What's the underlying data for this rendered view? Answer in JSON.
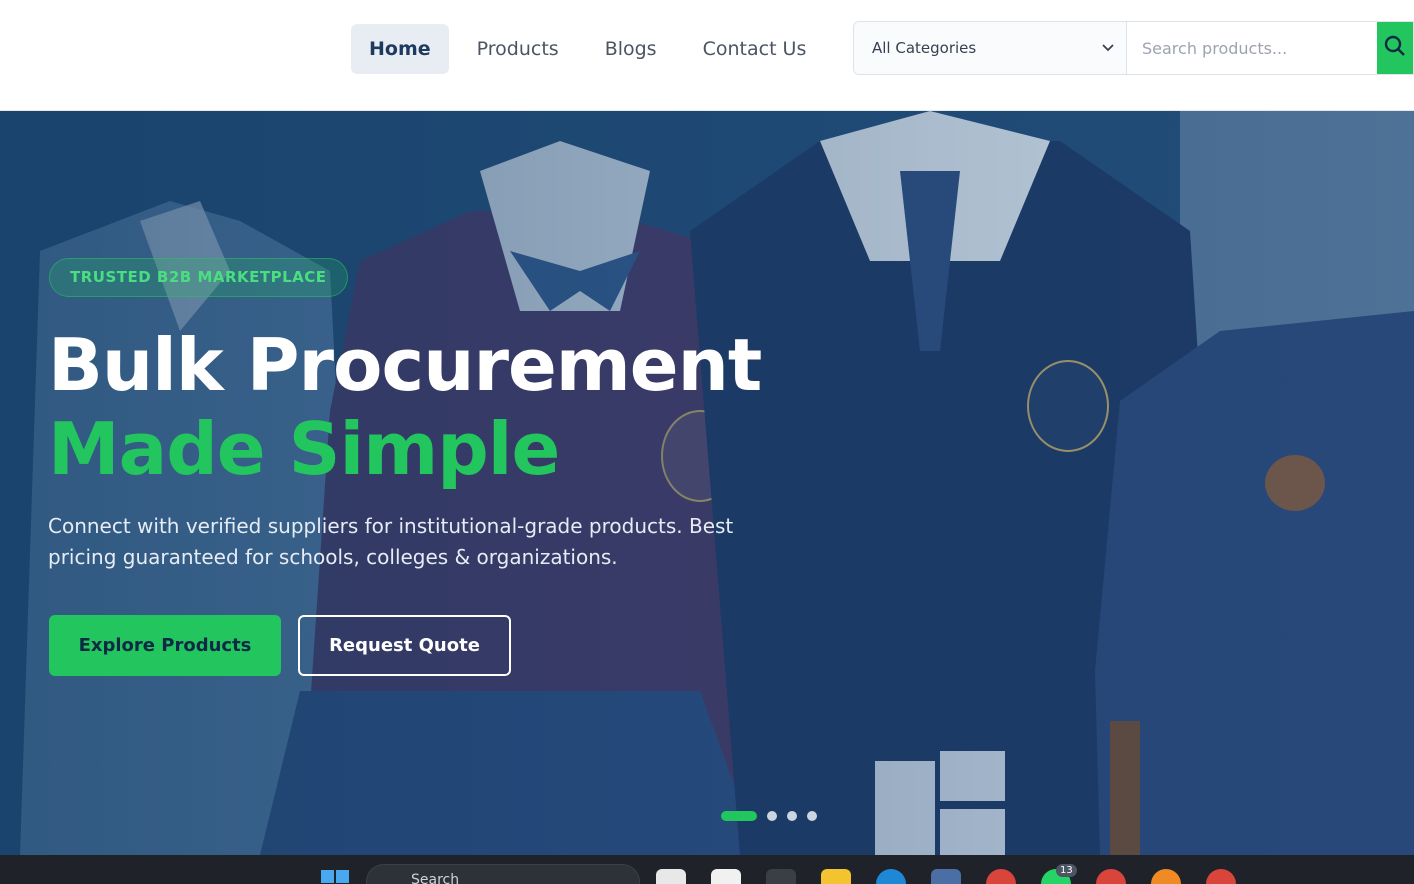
{
  "nav": {
    "items": [
      {
        "label": "Home",
        "active": true
      },
      {
        "label": "Products",
        "active": false
      },
      {
        "label": "Blogs",
        "active": false
      },
      {
        "label": "Contact Us",
        "active": false
      }
    ]
  },
  "search": {
    "category": "All Categories",
    "placeholder": "Search products..."
  },
  "hero": {
    "badge": "TRUSTED B2B MARKETPLACE",
    "title_line1": "Bulk Procurement",
    "title_line2": "Made Simple",
    "subtitle": "Connect with verified suppliers for institutional-grade products. Best pricing guaranteed for schools, colleges & organizations.",
    "primary_cta": "Explore Products",
    "secondary_cta": "Request Quote",
    "slides_total": 4,
    "slide_active": 1
  },
  "taskbar": {
    "search_text": "Search",
    "badge_count": "13"
  },
  "colors": {
    "accent": "#22c55e",
    "hero_bg": "#1c4a78",
    "nav_active_bg": "#e8edf3"
  }
}
